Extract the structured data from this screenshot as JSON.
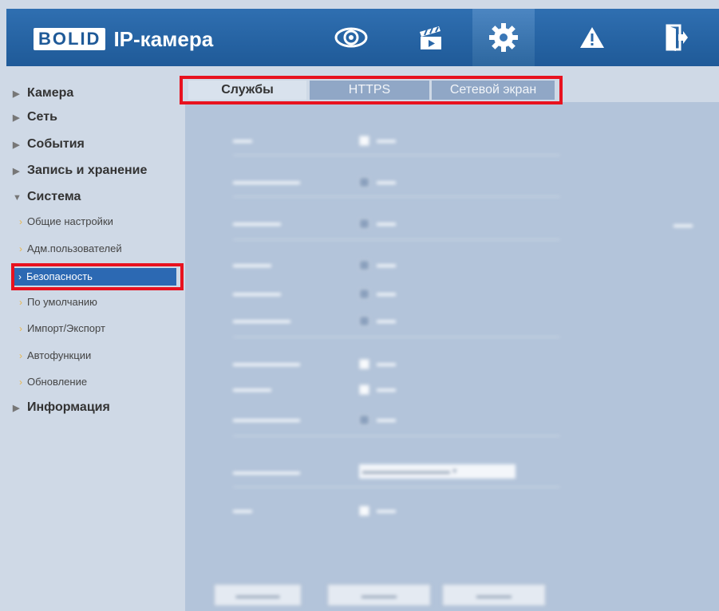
{
  "header": {
    "logo_brand": "BOLID",
    "logo_text": "IP-камера"
  },
  "nav": {
    "icons": [
      "eye-icon",
      "clapperboard-icon",
      "gear-icon",
      "warning-icon",
      "exit-icon"
    ],
    "active": "gear-icon"
  },
  "sidebar": {
    "items": [
      {
        "label": "Камера"
      },
      {
        "label": "Сеть"
      },
      {
        "label": "События"
      },
      {
        "label": "Запись и хранение"
      },
      {
        "label": "Система"
      },
      {
        "label": "Информация"
      }
    ],
    "system_sub": [
      {
        "label": "Общие настройки"
      },
      {
        "label": "Адм.пользователей"
      },
      {
        "label": "Безопасность"
      },
      {
        "label": "По умолчанию"
      },
      {
        "label": "Импорт/Экспорт"
      },
      {
        "label": "Автофункции"
      },
      {
        "label": "Обновление"
      }
    ],
    "selected": "Безопасность"
  },
  "tabs": [
    {
      "label": "Службы"
    },
    {
      "label": "HTTPS"
    },
    {
      "label": "Сетевой экран"
    }
  ],
  "colors": {
    "header": "#2a67a8",
    "highlight": "#e8121f",
    "selected": "#2c69b3",
    "content_bg": "#b3c4da"
  }
}
